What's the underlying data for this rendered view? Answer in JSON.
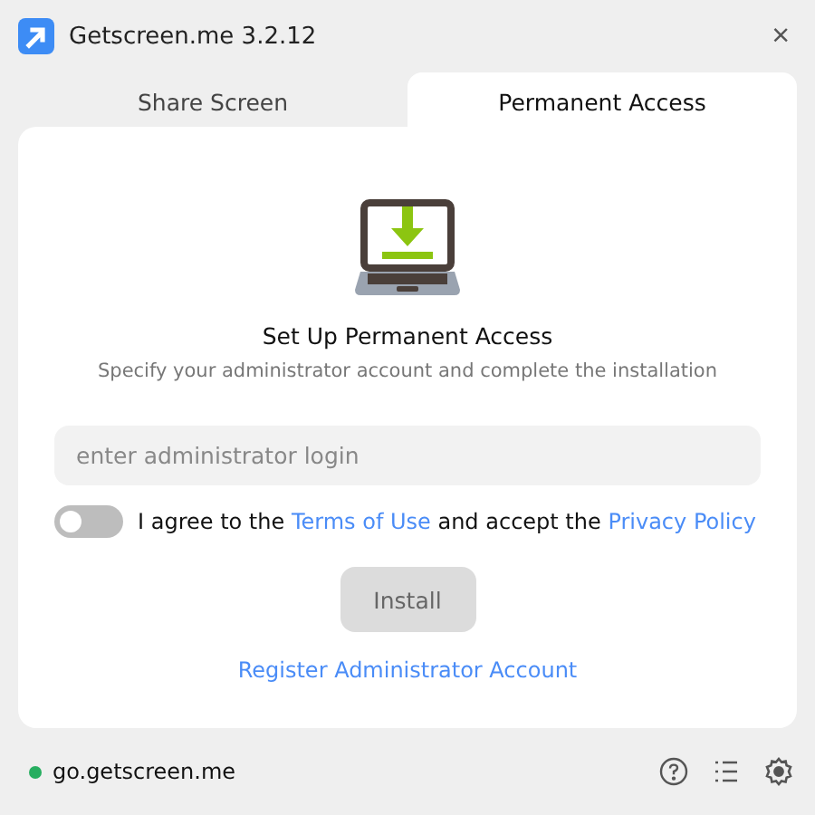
{
  "window": {
    "title": "Getscreen.me 3.2.12",
    "close": "×"
  },
  "tabs": [
    {
      "label": "Share Screen",
      "selected": false
    },
    {
      "label": "Permanent Access",
      "selected": true
    }
  ],
  "setup": {
    "heading": "Set Up Permanent Access",
    "description": "Specify your administrator account and complete the installation",
    "login": {
      "placeholder": "enter administrator login"
    },
    "agreement": {
      "on": false,
      "parts": [
        {
          "kind": "text",
          "text": "I agree to the "
        },
        {
          "kind": "link",
          "text": "Terms of Use"
        },
        {
          "kind": "text",
          "text": " and accept the "
        },
        {
          "kind": "link",
          "text": "Privacy Policy"
        }
      ]
    },
    "install": {
      "label": "Install",
      "disabled": true
    },
    "register_link": "Register Administrator Account"
  },
  "status_bar": {
    "connected": true,
    "server": "go.getscreen.me"
  }
}
